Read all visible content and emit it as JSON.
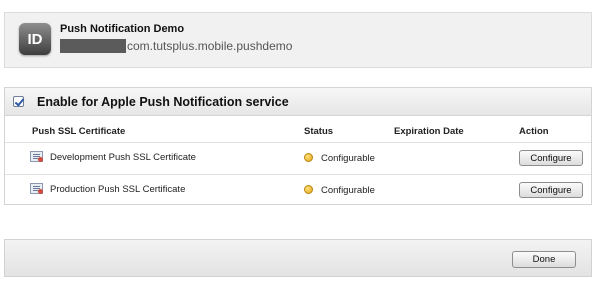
{
  "app": {
    "icon_text": "ID",
    "name": "Push Notification Demo",
    "bundle_id": "com.tutsplus.mobile.pushdemo"
  },
  "service": {
    "enabled": true,
    "label": "Enable for Apple Push Notification service"
  },
  "table": {
    "columns": [
      "Push SSL Certificate",
      "Status",
      "Expiration Date",
      "Action"
    ],
    "rows": [
      {
        "certificate": "Development Push SSL Certificate",
        "status": "Configurable",
        "expiration": "",
        "action": "Configure"
      },
      {
        "certificate": "Production Push SSL Certificate",
        "status": "Configurable",
        "expiration": "",
        "action": "Configure"
      }
    ]
  },
  "footer": {
    "done_label": "Done"
  },
  "icons": {
    "app": "app-id-icon",
    "certificate": "certificate-icon",
    "status": "status-dot-icon",
    "checkbox": "checkbox-checked-icon"
  },
  "colors": {
    "status_configurable": "#e4a314",
    "checkbox_accent": "#2f5aa8"
  }
}
